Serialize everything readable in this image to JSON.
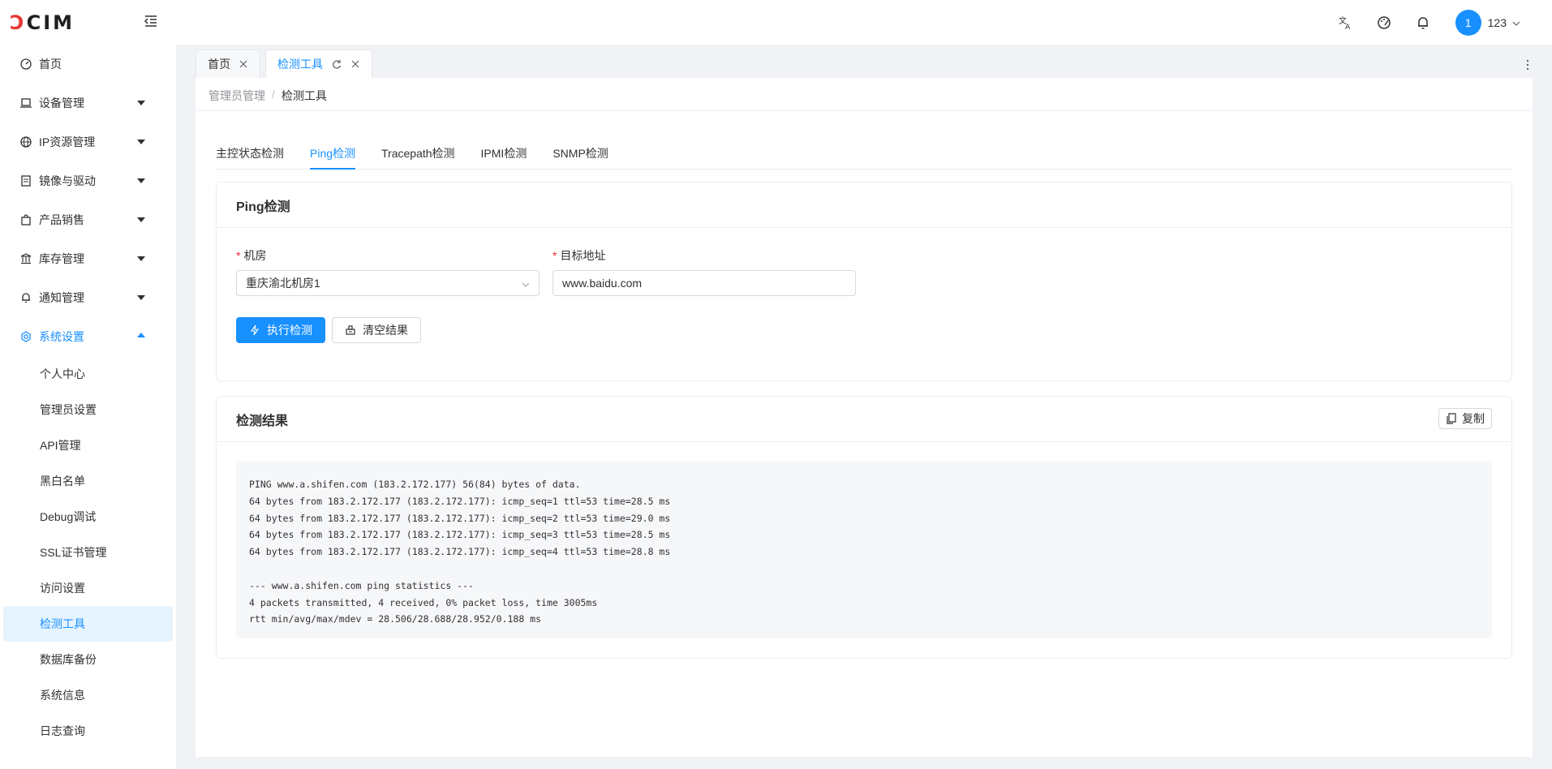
{
  "header": {
    "logo_prefix": "Ↄ",
    "logo_rest": "CIM",
    "avatar_text": "1",
    "username": "123"
  },
  "sidebar": {
    "items": [
      {
        "label": "首页",
        "icon": "dashboard-icon"
      },
      {
        "label": "设备管理",
        "icon": "laptop-icon"
      },
      {
        "label": "IP资源管理",
        "icon": "cloud-icon"
      },
      {
        "label": "镜像与驱动",
        "icon": "file-icon"
      },
      {
        "label": "产品销售",
        "icon": "shopping-icon"
      },
      {
        "label": "库存管理",
        "icon": "bank-icon"
      },
      {
        "label": "通知管理",
        "icon": "bell-icon"
      },
      {
        "label": "系统设置",
        "icon": "setting-icon"
      }
    ],
    "sub_items": [
      "个人中心",
      "管理员设置",
      "API管理",
      "黑白名单",
      "Debug调试",
      "SSL证书管理",
      "访问设置",
      "检测工具",
      "数据库备份",
      "系统信息",
      "日志查询"
    ],
    "active_sub": "检测工具"
  },
  "tabs": [
    {
      "label": "首页",
      "active": false
    },
    {
      "label": "检测工具",
      "active": true
    }
  ],
  "breadcrumb": {
    "parent": "管理员管理",
    "separator": "/",
    "current": "检测工具"
  },
  "tool_tabs": [
    "主控状态检测",
    "Ping检测",
    "Tracepath检测",
    "IPMI检测",
    "SNMP检测"
  ],
  "ping_card": {
    "title": "Ping检测",
    "room_label": "机房",
    "room_value": "重庆渝北机房1",
    "target_label": "目标地址",
    "target_value": "www.baidu.com",
    "run_button": "执行检测",
    "clear_button": "清空结果"
  },
  "result_card": {
    "title": "检测结果",
    "copy_button": "复制",
    "lines": [
      "PING www.a.shifen.com (183.2.172.177) 56(84) bytes of data.",
      "64 bytes from 183.2.172.177 (183.2.172.177): icmp_seq=1 ttl=53 time=28.5 ms",
      "64 bytes from 183.2.172.177 (183.2.172.177): icmp_seq=2 ttl=53 time=29.0 ms",
      "64 bytes from 183.2.172.177 (183.2.172.177): icmp_seq=3 ttl=53 time=28.5 ms",
      "64 bytes from 183.2.172.177 (183.2.172.177): icmp_seq=4 ttl=53 time=28.8 ms",
      "",
      "--- www.a.shifen.com ping statistics ---",
      "4 packets transmitted, 4 received, 0% packet loss, time 3005ms",
      "rtt min/avg/max/mdev = 28.506/28.688/28.952/0.188 ms"
    ]
  },
  "colors": {
    "primary": "#1890ff",
    "required": "#f5222d",
    "page_bg": "#f0f2f5"
  }
}
